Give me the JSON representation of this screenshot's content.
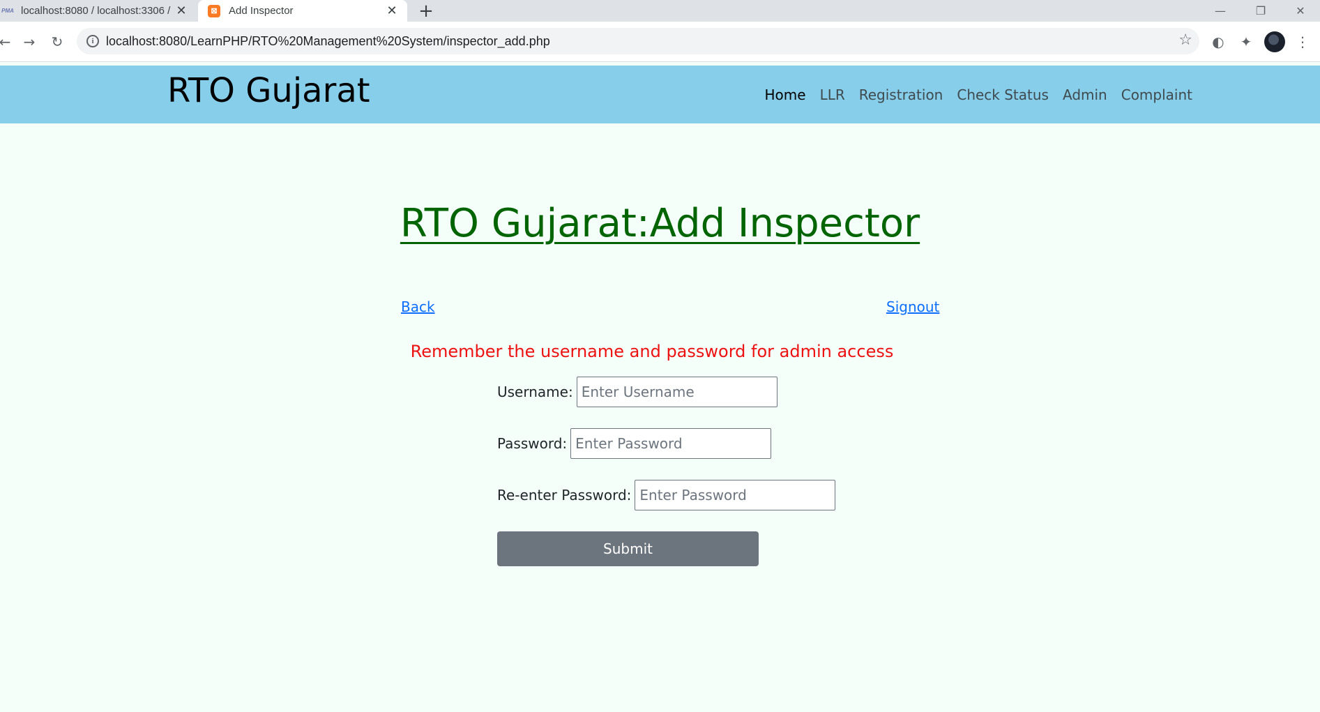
{
  "browser": {
    "tabs": [
      {
        "favicon": "PMA",
        "title": "localhost:8080 / localhost:3306 /",
        "close": "✕"
      },
      {
        "favicon": "⊠",
        "title": "Add Inspector",
        "close": "✕"
      }
    ],
    "new_tab": "+",
    "window": {
      "minimize": "—",
      "restore": "❐",
      "close": "✕"
    },
    "back": "←",
    "forward": "→",
    "reload": "↻",
    "info": "i",
    "url": "localhost:8080/LearnPHP/RTO%20Management%20System/inspector_add.php",
    "star": "☆",
    "ext1": "◐",
    "ext2": "✦",
    "menu": "⋮"
  },
  "header": {
    "brand": "RTO Gujarat",
    "nav": [
      {
        "label": "Home",
        "active": true
      },
      {
        "label": "LLR"
      },
      {
        "label": "Registration"
      },
      {
        "label": "Check Status"
      },
      {
        "label": "Admin"
      },
      {
        "label": "Complaint"
      }
    ]
  },
  "main": {
    "title": "RTO Gujarat:Add Inspector",
    "back_link": "Back",
    "signout_link": "Signout",
    "notice": "Remember the username and password for admin access",
    "form": {
      "username_label": "Username:",
      "username_placeholder": "Enter Username",
      "username_value": "",
      "password_label": "Password:",
      "password_placeholder": "Enter Password",
      "password_value": "",
      "repassword_label": "Re-enter Password:",
      "repassword_placeholder": "Enter Password",
      "repassword_value": "",
      "submit_label": "Submit"
    }
  },
  "colors": {
    "header_bg": "#87ceeb",
    "page_bg": "#f4fff9",
    "title": "#006400",
    "notice": "#ee1111",
    "link": "#0d6efd",
    "submit_bg": "#6c757d"
  }
}
